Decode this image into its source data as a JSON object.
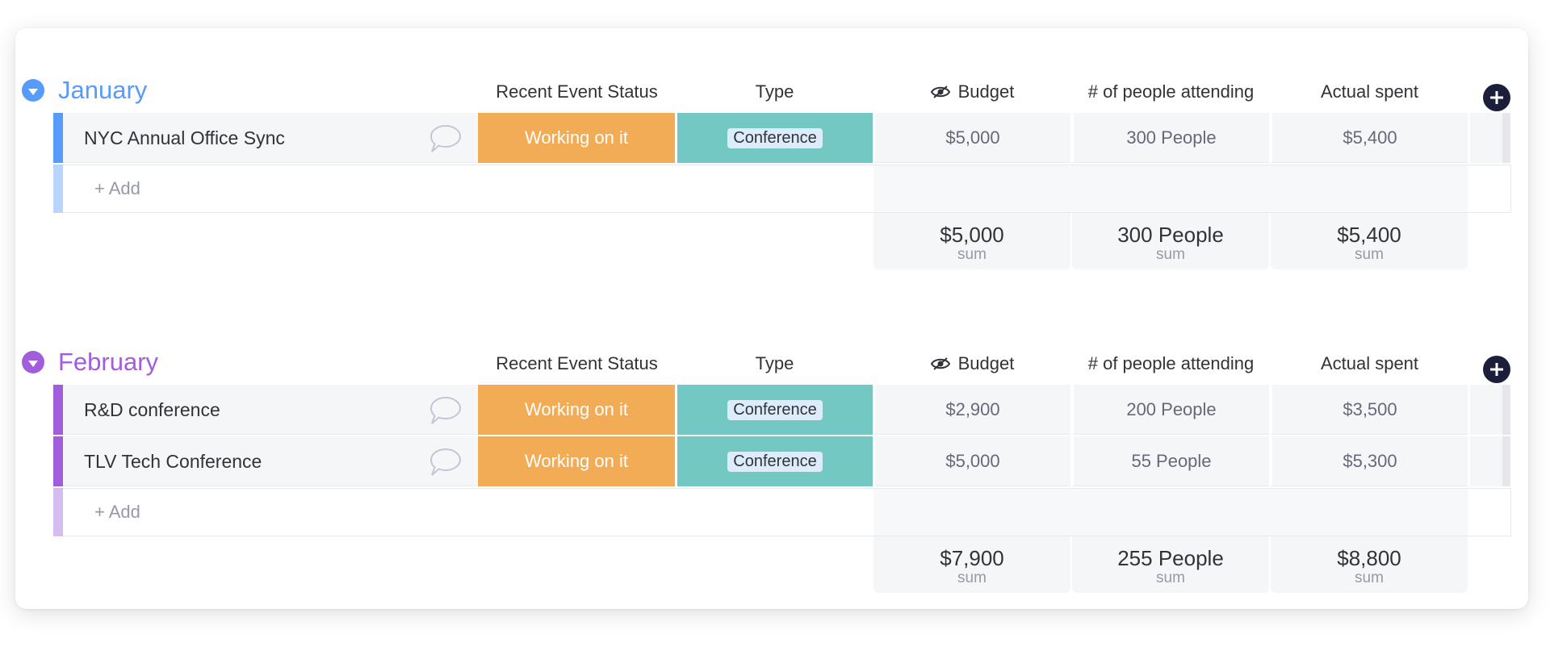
{
  "columns": {
    "status": "Recent Event Status",
    "type": "Type",
    "budget": "Budget",
    "people": "# of people attending",
    "spent": "Actual spent"
  },
  "sum_label": "sum",
  "add_label": "+ Add",
  "icons": {
    "collapse": "chevron-down-icon",
    "comment": "comment-icon",
    "visibility": "eye-icon",
    "add_column": "plus-icon"
  },
  "colors": {
    "january": "#579bfc",
    "january_light": "#b9d4fd",
    "february": "#a25ddc",
    "february_light": "#d6bdf0",
    "status_working": "#f2ac55",
    "type_conference": "#74c8c4"
  },
  "groups": [
    {
      "title": "January",
      "items": [
        {
          "name": "NYC Annual Office Sync",
          "status": "Working on it",
          "type": "Conference",
          "budget": "$5,000",
          "people": "300 People",
          "spent": "$5,400"
        }
      ],
      "sums": {
        "budget": "$5,000",
        "people": "300 People",
        "spent": "$5,400"
      }
    },
    {
      "title": "February",
      "items": [
        {
          "name": "R&D conference",
          "status": "Working on it",
          "type": "Conference",
          "budget": "$2,900",
          "people": "200 People",
          "spent": "$3,500"
        },
        {
          "name": "TLV Tech Conference",
          "status": "Working on it",
          "type": "Conference",
          "budget": "$5,000",
          "people": "55 People",
          "spent": "$5,300"
        }
      ],
      "sums": {
        "budget": "$7,900",
        "people": "255 People",
        "spent": "$8,800"
      }
    }
  ]
}
